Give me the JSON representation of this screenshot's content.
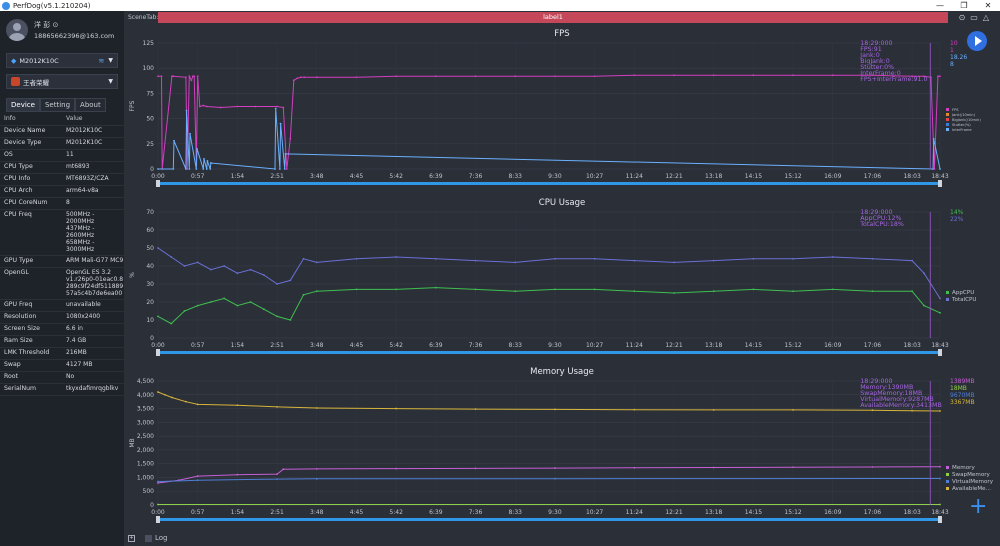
{
  "window": {
    "title": "PerfDog(v5.1.210204)"
  },
  "user": {
    "name": "洋 彭 ⊙",
    "email": "18865662396@163.com"
  },
  "device_selector": {
    "value": "M2012K10C"
  },
  "app_selector": {
    "value": "王者荣耀"
  },
  "tabs": [
    {
      "label": "Device"
    },
    {
      "label": "Setting"
    },
    {
      "label": "About"
    }
  ],
  "info_table": {
    "headers": {
      "k": "Info",
      "v": "Value"
    },
    "rows": [
      {
        "k": "Device Name",
        "v": "M2012K10C"
      },
      {
        "k": "Device Type",
        "v": "M2012K10C"
      },
      {
        "k": "OS",
        "v": "11"
      },
      {
        "k": "CPU Type",
        "v": "mt6893"
      },
      {
        "k": "CPU Info",
        "v": "MT6893Z/CZA"
      },
      {
        "k": "CPU Arch",
        "v": "arm64-v8a"
      },
      {
        "k": "CPU CoreNum",
        "v": "8"
      },
      {
        "k": "CPU Freq",
        "v": "500MHz - 2000MHz\n437MHz - 2600MHz\n658MHz - 3000MHz"
      },
      {
        "k": "GPU Type",
        "v": "ARM Mali-G77 MC9"
      },
      {
        "k": "OpenGL",
        "v": "OpenGL ES 3.2\nv1.r26p0-01eac0.8\n289c9f24df511889\n57a5c4b7de6ea00"
      },
      {
        "k": "GPU Freq",
        "v": "unavailable"
      },
      {
        "k": "Resolution",
        "v": "1080x2400"
      },
      {
        "k": "Screen Size",
        "v": "6.6 in"
      },
      {
        "k": "Ram Size",
        "v": "7.4 GB"
      },
      {
        "k": "LMK Threshold",
        "v": "216MB"
      },
      {
        "k": "Swap",
        "v": "4127 MB"
      },
      {
        "k": "Root",
        "v": "No"
      },
      {
        "k": "SerialNum",
        "v": "tkyxdafimrqgblkv"
      }
    ]
  },
  "scene": {
    "tab_label": "SceneTab:",
    "label": "label1"
  },
  "log": {
    "label": "Log"
  },
  "colors": {
    "fps": "#d23fc2",
    "jank": "#e08a2a",
    "bigjank": "#e64646",
    "stutter": "#3a7fd6",
    "interframe": "#6ab0ff",
    "appcpu": "#3fbf4f",
    "totalcpu": "#6a70d6",
    "memory": "#c65fd8",
    "swap": "#8ed04a",
    "virtual": "#4f7fd6",
    "available": "#d8b53a",
    "slider": "#2f96e8",
    "accent": "#2f6fe0"
  },
  "time_ticks": [
    "0:00",
    "0:57",
    "1:54",
    "2:51",
    "3:48",
    "4:45",
    "5:42",
    "6:39",
    "7:36",
    "8:33",
    "9:30",
    "10:27",
    "11:24",
    "12:21",
    "13:18",
    "14:15",
    "15:12",
    "16:09",
    "17:06",
    "18:03",
    "18:43"
  ],
  "chart_data": [
    {
      "type": "line",
      "title": "FPS",
      "ylabel": "FPS",
      "ylim": [
        0,
        125
      ],
      "yticks": [
        "0",
        "25",
        "50",
        "75",
        "100",
        "125"
      ],
      "legend": [
        "FPS",
        "Jank(/10min)",
        "BigJank(/10min)",
        "Stutter(%)",
        "InterFrame"
      ],
      "legend_position": "right",
      "cursor": {
        "time": "18:29:000",
        "lines": [
          "FPS:91",
          "Jank:0",
          "BigJank:0",
          "Stutter:0%",
          "InterFrame:0",
          "FPS+InterFrame:91.0"
        ]
      },
      "current_values": [
        "10",
        "1",
        "18.26",
        "8"
      ],
      "series": [
        {
          "name": "FPS",
          "x": [
            "0:00",
            "0:05",
            "0:06",
            "0:20",
            "0:22",
            "0:40",
            "0:42",
            "0:45",
            "0:48",
            "0:50",
            "0:52",
            "0:55",
            "0:57",
            "1:00",
            "1:05",
            "1:10",
            "1:30",
            "1:54",
            "2:20",
            "2:51",
            "3:00",
            "3:05",
            "3:10",
            "3:15",
            "3:20",
            "3:25",
            "3:30",
            "3:48",
            "4:45",
            "5:42",
            "6:39",
            "7:36",
            "8:33",
            "9:30",
            "10:27",
            "11:24",
            "12:21",
            "13:18",
            "14:15",
            "15:12",
            "16:09",
            "17:06",
            "18:03",
            "18:20",
            "18:30",
            "18:35",
            "18:40",
            "18:43"
          ],
          "values": [
            92,
            92,
            0,
            92,
            92,
            91,
            0,
            92,
            88,
            92,
            92,
            5,
            92,
            62,
            63,
            62,
            61,
            62,
            62,
            62,
            61,
            0,
            30,
            88,
            90,
            91,
            91,
            91,
            91,
            92,
            92,
            92,
            92,
            92,
            92,
            93,
            93,
            93,
            93,
            93,
            93,
            93,
            92,
            92,
            91,
            0,
            92,
            92
          ]
        },
        {
          "name": "InterFrame",
          "x": [
            "0:00",
            "0:22",
            "0:23",
            "0:40",
            "0:41",
            "0:45",
            "0:46",
            "0:55",
            "0:56",
            "1:05",
            "1:06",
            "1:10",
            "1:11",
            "1:15",
            "1:16",
            "2:48",
            "2:49",
            "2:55",
            "2:56",
            "3:02",
            "3:03",
            "18:33",
            "18:34",
            "18:43"
          ],
          "values": [
            0,
            0,
            28,
            0,
            58,
            0,
            35,
            0,
            20,
            0,
            10,
            0,
            8,
            0,
            6,
            0,
            60,
            0,
            45,
            0,
            15,
            0,
            30,
            0
          ]
        }
      ]
    },
    {
      "type": "line",
      "title": "CPU Usage",
      "ylabel": "%",
      "ylim": [
        0,
        70
      ],
      "yticks": [
        "0",
        "10",
        "20",
        "30",
        "40",
        "50",
        "60",
        "70"
      ],
      "legend": [
        "AppCPU",
        "TotalCPU"
      ],
      "legend_position": "right",
      "cursor": {
        "time": "18:29:000",
        "lines": [
          "AppCPU:12%",
          "TotalCPU:18%"
        ]
      },
      "current_values": [
        "14%",
        "22%"
      ],
      "series": [
        {
          "name": "AppCPU",
          "x": [
            "0:00",
            "0:19",
            "0:38",
            "0:57",
            "1:16",
            "1:35",
            "1:54",
            "2:13",
            "2:32",
            "2:51",
            "3:10",
            "3:29",
            "3:48",
            "4:45",
            "5:42",
            "6:39",
            "7:36",
            "8:33",
            "9:30",
            "10:27",
            "11:24",
            "12:21",
            "13:18",
            "14:15",
            "15:12",
            "16:09",
            "17:06",
            "18:03",
            "18:20",
            "18:43"
          ],
          "values": [
            12,
            8,
            15,
            18,
            20,
            22,
            18,
            20,
            16,
            12,
            10,
            24,
            26,
            27,
            27,
            28,
            27,
            26,
            27,
            27,
            26,
            25,
            26,
            27,
            26,
            27,
            26,
            26,
            18,
            14
          ]
        },
        {
          "name": "TotalCPU",
          "x": [
            "0:00",
            "0:19",
            "0:38",
            "0:57",
            "1:16",
            "1:35",
            "1:54",
            "2:13",
            "2:32",
            "2:51",
            "3:10",
            "3:29",
            "3:48",
            "4:45",
            "5:42",
            "6:39",
            "7:36",
            "8:33",
            "9:30",
            "10:27",
            "11:24",
            "12:21",
            "13:18",
            "14:15",
            "15:12",
            "16:09",
            "17:06",
            "18:03",
            "18:20",
            "18:43"
          ],
          "values": [
            50,
            45,
            40,
            42,
            38,
            40,
            36,
            38,
            35,
            30,
            32,
            44,
            42,
            44,
            45,
            44,
            43,
            42,
            44,
            44,
            43,
            42,
            43,
            44,
            44,
            45,
            44,
            43,
            36,
            22
          ]
        }
      ]
    },
    {
      "type": "line",
      "title": "Memory Usage",
      "ylabel": "MB",
      "ylim": [
        0,
        4500
      ],
      "yticks": [
        "0",
        "500",
        "1,000",
        "1,500",
        "2,000",
        "2,500",
        "3,000",
        "3,500",
        "4,000",
        "4,500"
      ],
      "legend": [
        "Memory",
        "SwapMemory",
        "VirtualMemory",
        "AvailableMe..."
      ],
      "legend_position": "right",
      "cursor": {
        "time": "18:29:000",
        "lines": [
          "Memory:1390MB",
          "SwapMemory:18MB",
          "VirtualMemory:9287MB",
          "AvailableMemory:3413MB"
        ]
      },
      "current_values": [
        "1389MB",
        "18MB",
        "9670MB",
        "3367MB"
      ],
      "series": [
        {
          "name": "Memory",
          "x": [
            "0:00",
            "0:30",
            "0:57",
            "1:54",
            "2:51",
            "3:00",
            "3:48",
            "5:42",
            "7:36",
            "9:30",
            "11:24",
            "13:18",
            "15:12",
            "17:06",
            "18:43"
          ],
          "values": [
            800,
            900,
            1050,
            1100,
            1120,
            1300,
            1310,
            1320,
            1330,
            1340,
            1350,
            1360,
            1370,
            1380,
            1390
          ]
        },
        {
          "name": "SwapMemory",
          "x": [
            "0:00",
            "18:43"
          ],
          "values": [
            18,
            18
          ]
        },
        {
          "name": "VirtualMemory",
          "x": [
            "0:00",
            "0:57",
            "2:51",
            "3:48",
            "9:30",
            "18:43"
          ],
          "values": [
            850,
            900,
            940,
            950,
            955,
            960
          ]
        },
        {
          "name": "AvailableMemory",
          "x": [
            "0:00",
            "0:10",
            "0:20",
            "0:40",
            "0:57",
            "1:54",
            "2:51",
            "3:48",
            "5:42",
            "7:36",
            "9:30",
            "11:24",
            "13:18",
            "15:12",
            "17:06",
            "18:03",
            "18:43"
          ],
          "values": [
            4100,
            4000,
            3900,
            3750,
            3650,
            3620,
            3560,
            3520,
            3500,
            3480,
            3470,
            3460,
            3450,
            3450,
            3440,
            3420,
            3410
          ]
        }
      ]
    }
  ]
}
